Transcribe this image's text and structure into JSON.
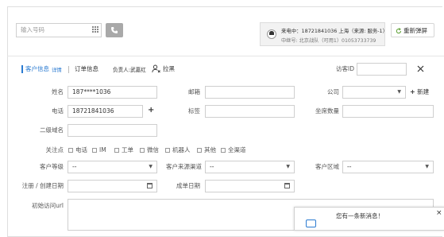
{
  "topbar": {
    "dial_input": {
      "placeholder": "输入号码"
    },
    "caller": {
      "line1": "来电中：18721841036  上海（来源: 服务-1）",
      "line2": "中继号: 北京战队（可用1）01053733739"
    },
    "refresh_label": "重新弹屏"
  },
  "tabs": {
    "customer_info": "客户信息",
    "detail": "详情",
    "order_info": "订单信息",
    "owner": "负责人:武嘉红",
    "blacklist": "拉黑"
  },
  "visitor": {
    "label": "访客ID"
  },
  "form": {
    "name": {
      "label": "姓名",
      "value": "187****1036"
    },
    "email": {
      "label": "邮箱",
      "value": ""
    },
    "company": {
      "label": "公司",
      "value": ""
    },
    "new_label": "新建",
    "phone": {
      "label": "电话",
      "value": "18721841036"
    },
    "tags": {
      "label": "标签",
      "value": ""
    },
    "seats": {
      "label": "坐席数量",
      "value": ""
    },
    "subdomain": {
      "label": "二级域名",
      "value": ""
    },
    "focus": {
      "label": "关注点",
      "options": [
        "电话",
        "IM",
        "工单",
        "微信",
        "机器人",
        "其他",
        "全渠道"
      ]
    },
    "level": {
      "label": "客户等级",
      "value": "--"
    },
    "source": {
      "label": "客户来源渠道",
      "value": "--"
    },
    "region": {
      "label": "客户区域",
      "value": "--"
    },
    "register_date": {
      "label": "注册 / 创建日期",
      "value": ""
    },
    "deal_date": {
      "label": "成单日期",
      "value": ""
    },
    "first_url": {
      "label": "初始访问url",
      "value": ""
    }
  },
  "notification": {
    "text": "您有一条新消息！",
    "close": "×"
  }
}
